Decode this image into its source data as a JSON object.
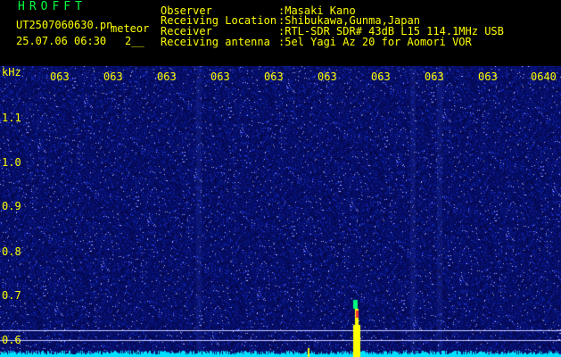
{
  "header": {
    "logo": "HROFFT",
    "filename": "UT2507060630.pn",
    "filename_suffix": "meteor",
    "datetime": "25.07.06 06:30",
    "count": "2__",
    "rows": [
      {
        "label": "Observer",
        "value": ":Masaki Kano"
      },
      {
        "label": "Receiving Location",
        "value": ":Shibukawa,Gunma,Japan"
      },
      {
        "label": "Receiver",
        "value": ":RTL-SDR SDR# 43dB L15 114.1MHz USB"
      },
      {
        "label": "Receiving antenna",
        "value": ":5el Yagi Az 20 for Aomori VOR"
      }
    ]
  },
  "axis": {
    "unit": "kHz",
    "y_labels": [
      "1.1",
      "1.0",
      "0.9",
      "0.8",
      "0.7",
      "0.6"
    ],
    "x_ticks": [
      "063",
      "063",
      "063",
      "063",
      "063",
      "063",
      "063",
      "063",
      "063",
      "0640"
    ]
  },
  "colors": {
    "text": "#ffff00",
    "logo": "#00ff40",
    "background_noise": "#0a0a6a",
    "noise_floor": "#00e0ff",
    "meteor_echo": "#ffff00"
  }
}
